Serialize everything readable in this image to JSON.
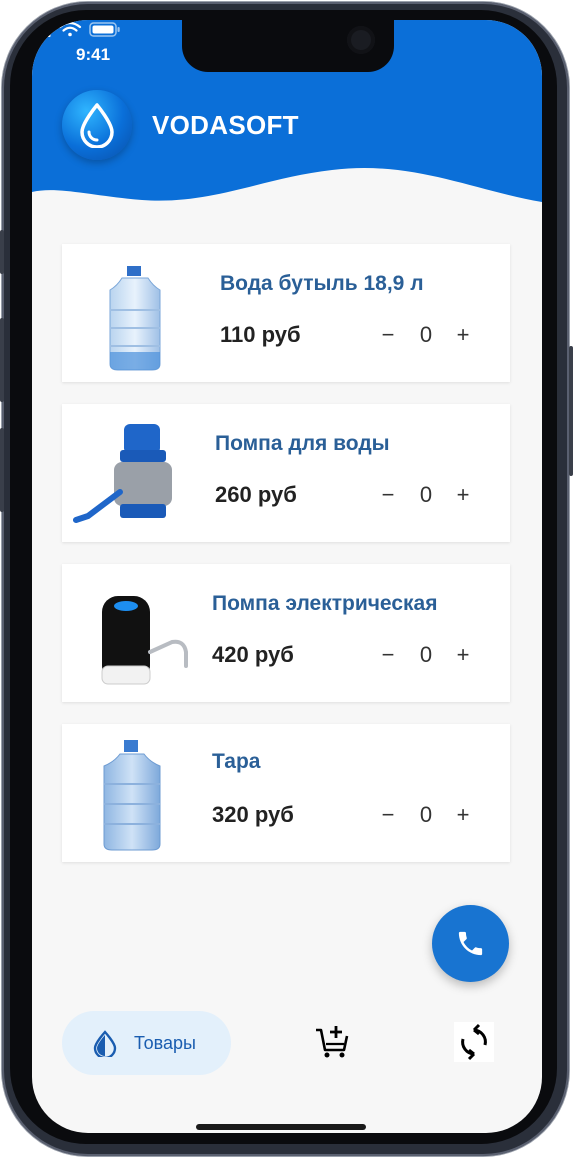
{
  "status_bar": {
    "time": "9:41"
  },
  "header": {
    "brand": "VODASOFT",
    "color": "#0b6fd8"
  },
  "products": [
    {
      "title": "Вода бутыль 18,9 л",
      "price": "110 руб",
      "qty": "0",
      "minus": "−",
      "plus": "+",
      "image": "water-bottle-image"
    },
    {
      "title": "Помпа для воды",
      "price": "260 руб",
      "qty": "0",
      "minus": "−",
      "plus": "+",
      "image": "water-pump-image"
    },
    {
      "title": "Помпа электрическая",
      "price": "420 руб",
      "qty": "0",
      "minus": "−",
      "plus": "+",
      "image": "electric-pump-image"
    },
    {
      "title": "Тара",
      "price": "320 руб",
      "qty": "0",
      "minus": "−",
      "plus": "+",
      "image": "empty-bottle-image"
    }
  ],
  "fab": {
    "icon": "phone-icon"
  },
  "bottom_nav": {
    "items": [
      {
        "label": "Товары",
        "icon": "drop-icon",
        "active": true
      },
      {
        "label": "",
        "icon": "cart-add-icon",
        "active": false
      },
      {
        "label": "",
        "icon": "refresh-icon",
        "active": false
      }
    ]
  }
}
